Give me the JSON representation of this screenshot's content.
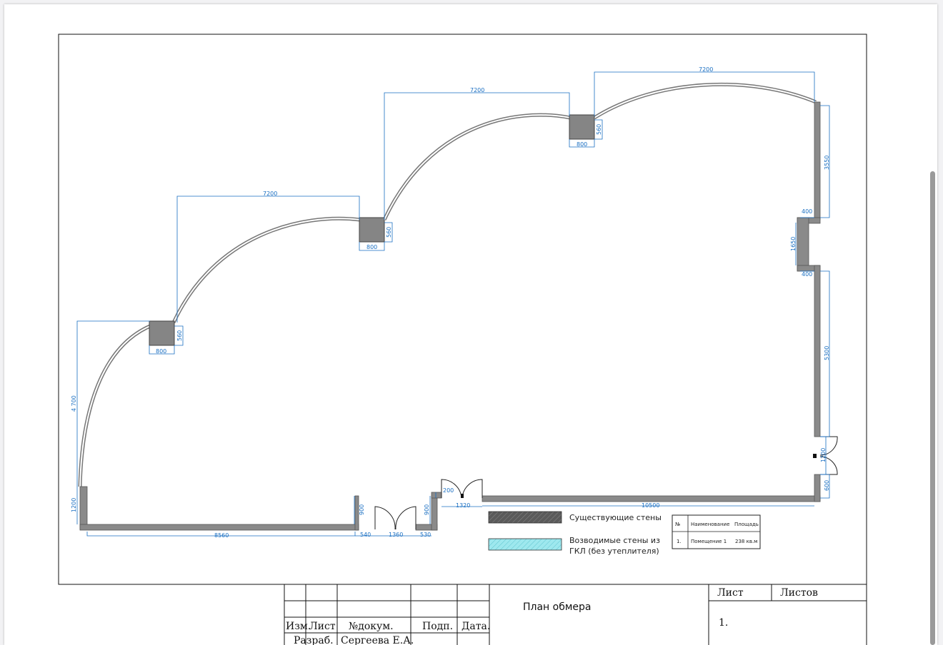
{
  "plan": {
    "dimensions": {
      "arc_top_1": "7200",
      "arc_top_2": "7200",
      "arc_top_3": "7200",
      "column_w_1": "800",
      "column_w_2": "800",
      "column_w_3": "800",
      "column_h_1": "560",
      "column_h_2": "560",
      "column_h_3": "560",
      "left_4700": "4 700",
      "left_1200": "1200",
      "bottom_8560": "8560",
      "bottom_540": "540",
      "bottom_1360": "1360",
      "bottom_530": "530",
      "v_900_a": "900",
      "v_900_b": "900",
      "v_200": "200",
      "bottom_1320": "1320",
      "bottom_10500": "10500",
      "right_3550": "3550",
      "right_400_a": "400",
      "right_1650": "1650",
      "right_400_b": "400",
      "right_5300": "5300",
      "right_1200": "1200",
      "right_600": "600"
    }
  },
  "legend": {
    "existing_walls": "Существующие стены",
    "new_walls_line1": "Возводимые стены из",
    "new_walls_line2": "ГКЛ (без утеплителя)",
    "existing_color": "#5a5a5a",
    "new_color": "#9ee8ee"
  },
  "area_table": {
    "headers": [
      "№",
      "Наименование",
      "Площадь"
    ],
    "rows": [
      {
        "num": "1.",
        "name": "Помещение 1",
        "area": "238 кв.м"
      }
    ]
  },
  "title_block": {
    "title": "План обмера",
    "sheet_label": "Лист",
    "sheets_label": "Листов",
    "sheet_number": "1.",
    "col_izm": "Изм.",
    "col_list": "Лист",
    "col_doc": "№докум.",
    "col_sign": "Подп.",
    "col_date": "Дата.",
    "role_dev": "Разраб.",
    "dev_name": "Сергеева Е.А."
  },
  "colors": {
    "wall": "#7a7a7a",
    "dimension": "#1a6fc2"
  }
}
